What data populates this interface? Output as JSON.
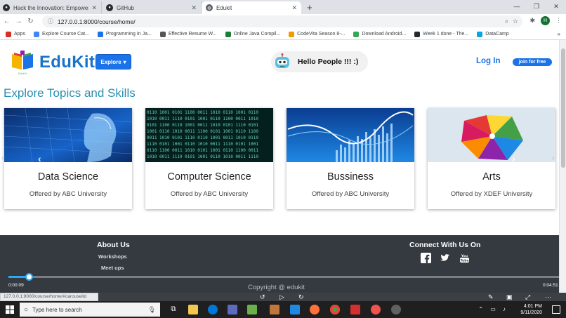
{
  "browser": {
    "tabs": [
      {
        "title": "Hack the Innovation: Empowerin",
        "active": false
      },
      {
        "title": "GitHub",
        "active": false
      },
      {
        "title": "Edukit",
        "active": true
      }
    ],
    "new_tab": "+",
    "url": "127.0.0.1:8000/course/home/",
    "profile_initial": "H",
    "bookmarks": [
      {
        "label": "Apps",
        "color": "#d93025"
      },
      {
        "label": "Explore Course Cat...",
        "color": "#4285f4"
      },
      {
        "label": "Programming In Ja...",
        "color": "#1a73e8"
      },
      {
        "label": "Effective Resume W...",
        "color": "#555555"
      },
      {
        "label": "Online Java Compil...",
        "color": "#188038"
      },
      {
        "label": "CodeVita Season 8-...",
        "color": "#f29900"
      },
      {
        "label": "Download Android...",
        "color": "#34a853"
      },
      {
        "label": "Week 1 done - The...",
        "color": "#24292e"
      },
      {
        "label": "DataCamp",
        "color": "#05a5e6"
      }
    ],
    "bookmarks_more": "»"
  },
  "header": {
    "logo_text": "EduKit",
    "logo_sub": "EduKit",
    "explore_label": "Explore",
    "greeting": "Hello People !!! :)",
    "login_label": "Log In",
    "join_label": "join for free"
  },
  "main": {
    "section_title": "Explore Topics and Skills",
    "courses": [
      {
        "name": "Data Science",
        "offered_by": "Offered by ABC University"
      },
      {
        "name": "Computer Science",
        "offered_by": "Offered by ABC University"
      },
      {
        "name": "Bussiness",
        "offered_by": "Offered by ABC University"
      },
      {
        "name": "Arts",
        "offered_by": "Offered by XDEF University"
      }
    ]
  },
  "footer": {
    "about_title": "About Us",
    "links": [
      "Workshops",
      "Meet ups"
    ],
    "connect_title": "Connect With Us On",
    "copyright": "Copyright @ edukit"
  },
  "player": {
    "current_time": "0:00:09",
    "total_time": "0:04:51",
    "progress_fraction": 0.037,
    "status_url": "127.0.0.1:8000/course/home/#carouselId"
  },
  "taskbar": {
    "search_placeholder": "Type here to search",
    "time": "4:01 PM",
    "date": "9/11/2020"
  },
  "colors": {
    "brand_blue": "#1a73e8",
    "section_title": "#2a8fb0",
    "footer_bg": "#343a40",
    "seek_blue": "#2aa8f2"
  }
}
